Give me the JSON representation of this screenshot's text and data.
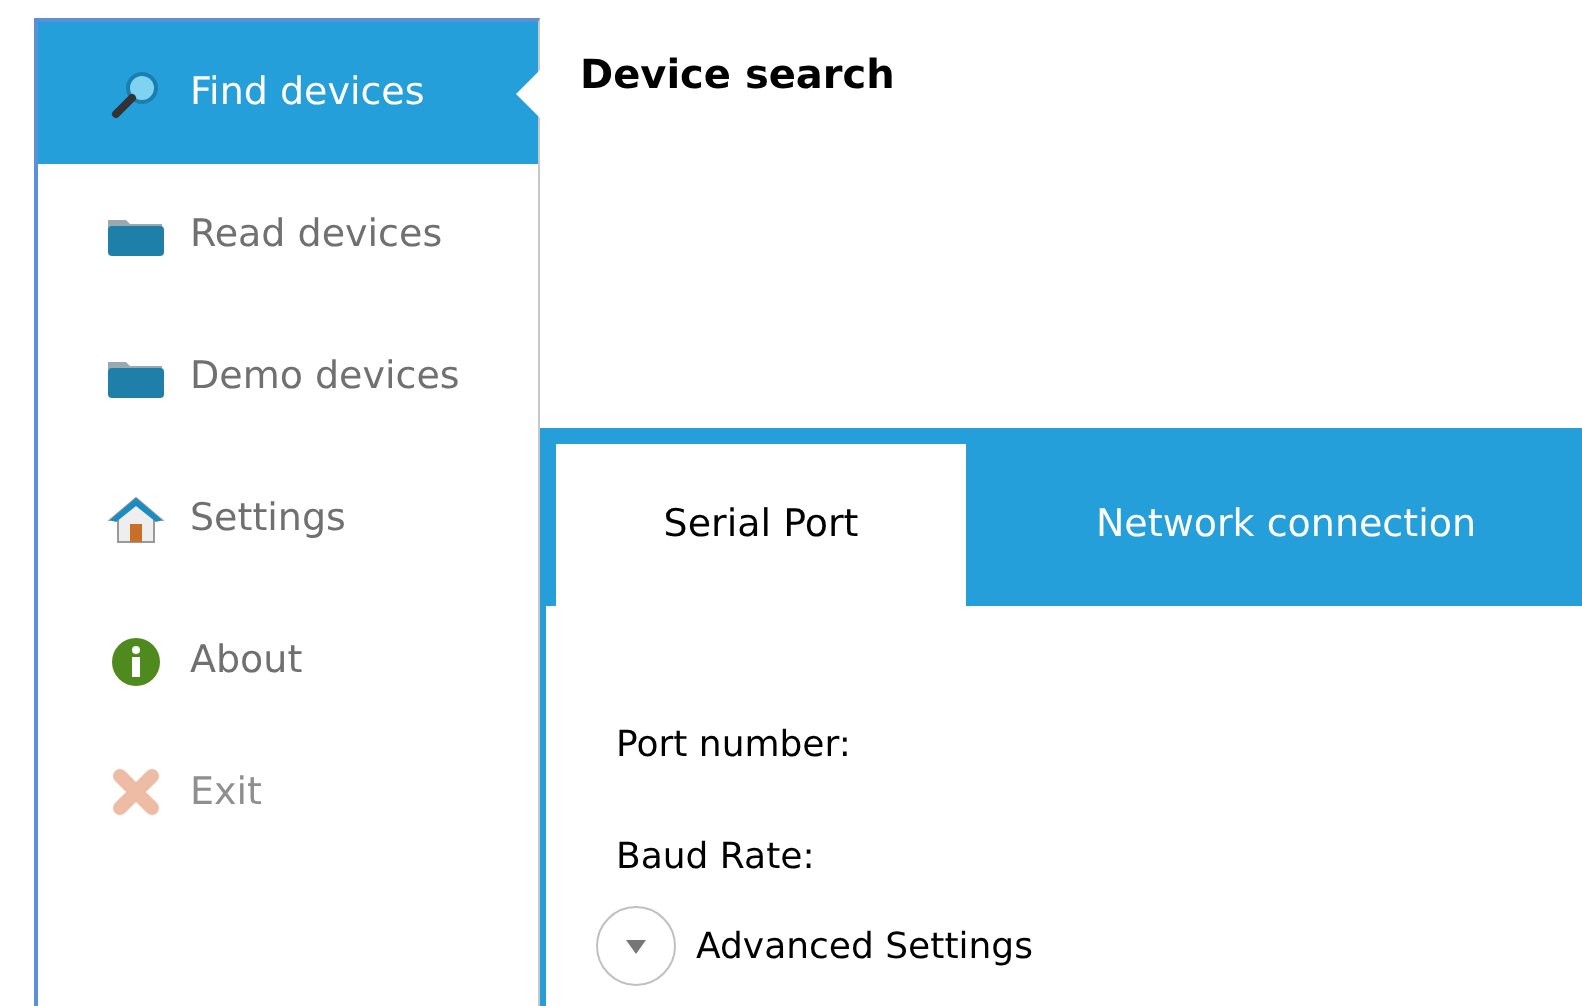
{
  "sidebar": {
    "items": [
      {
        "label": "Find devices",
        "kind": "search",
        "selected": true,
        "disabled": false
      },
      {
        "label": "Read devices",
        "kind": "folder",
        "selected": false,
        "disabled": false
      },
      {
        "label": "Demo devices",
        "kind": "folder",
        "selected": false,
        "disabled": false
      },
      {
        "label": "Settings",
        "kind": "home",
        "selected": false,
        "disabled": false
      },
      {
        "label": "About",
        "kind": "info",
        "selected": false,
        "disabled": false
      },
      {
        "label": "Exit",
        "kind": "close",
        "selected": false,
        "disabled": true
      }
    ]
  },
  "main": {
    "title": "Device search",
    "tabs": [
      {
        "label": "Serial Port",
        "selected": true
      },
      {
        "label": "Network connection",
        "selected": false
      }
    ],
    "fields": [
      {
        "label": "Port number:"
      },
      {
        "label": "Baud Rate:"
      }
    ],
    "advanced": {
      "label": "Advanced Settings",
      "expanded": false
    }
  }
}
